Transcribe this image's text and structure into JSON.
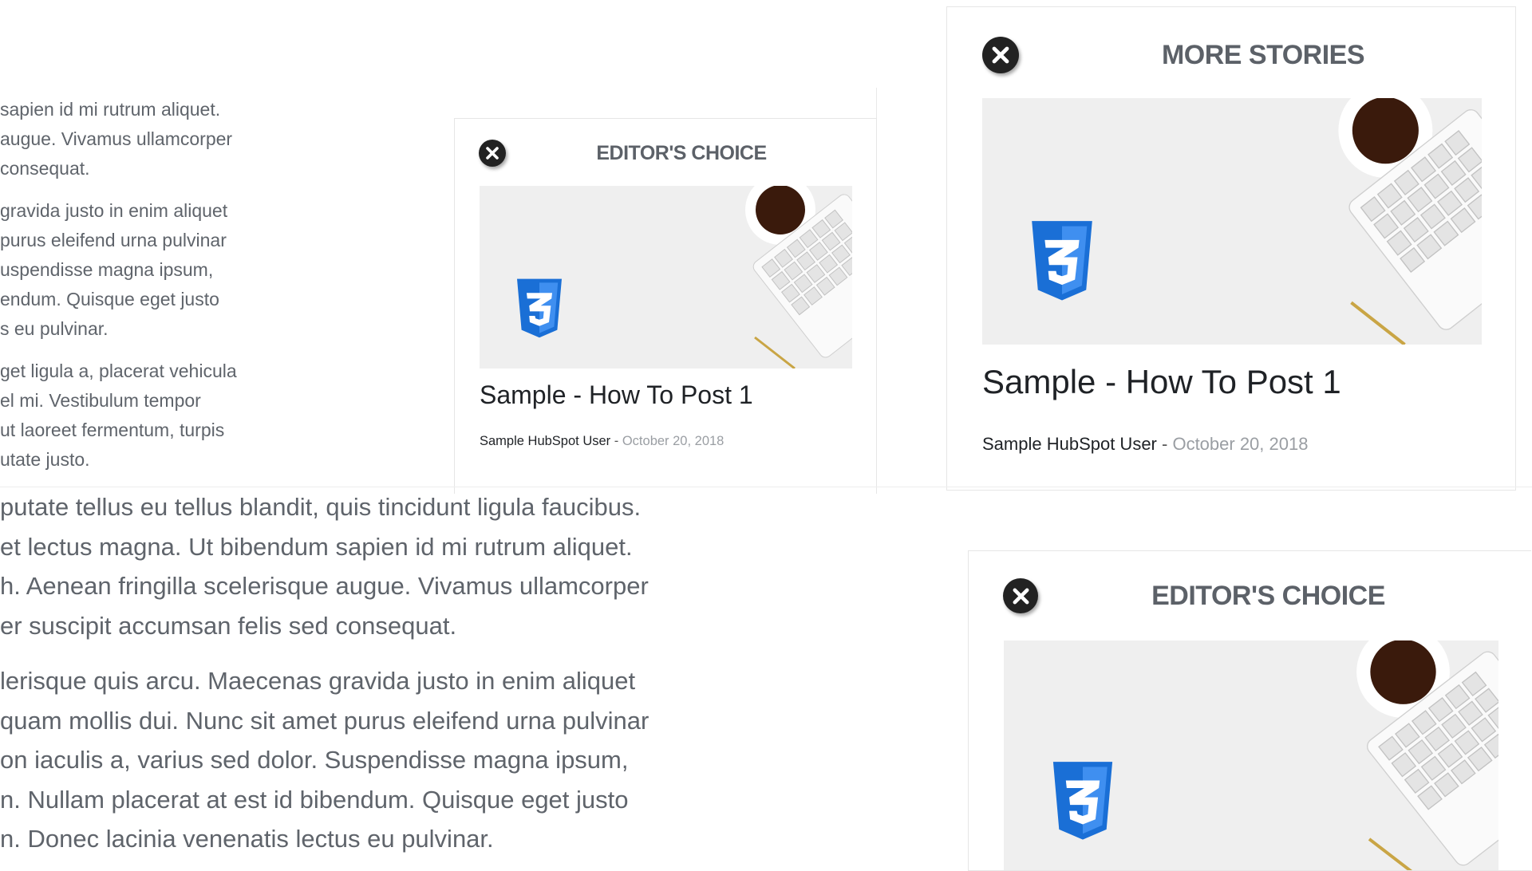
{
  "top_left_paragraphs": [
    [
      "sapien id mi rutrum aliquet.",
      "augue. Vivamus ullamcorper",
      "consequat."
    ],
    [
      "gravida justo in enim aliquet",
      "purus eleifend urna pulvinar",
      "uspendisse magna ipsum,",
      "endum. Quisque eget justo",
      "s eu pulvinar."
    ],
    [
      "get ligula a, placerat vehicula",
      "el mi. Vestibulum tempor",
      "ut laoreet fermentum, turpis",
      "utate justo."
    ]
  ],
  "bottom_left_paragraphs": [
    [
      "putate tellus eu tellus blandit, quis tincidunt ligula faucibus.",
      "et lectus magna. Ut bibendum sapien id mi rutrum aliquet.",
      "h. Aenean fringilla scelerisque augue. Vivamus ullamcorper",
      "er suscipit accumsan felis sed consequat."
    ],
    [
      "lerisque quis arcu. Maecenas gravida justo in enim aliquet",
      "quam mollis dui. Nunc sit amet purus eleifend urna pulvinar",
      "on iaculis a, varius sed dolor. Suspendisse magna ipsum,",
      "n. Nullam placerat at est id bibendum. Quisque eget justo",
      "n. Donec lacinia venenatis lectus eu pulvinar."
    ]
  ],
  "cards": {
    "editors_choice_small": {
      "heading": "EDITOR'S CHOICE",
      "post_title": "Sample - How To Post 1",
      "author": "Sample HubSpot User",
      "separator": " - ",
      "date": "October 20, 2018"
    },
    "more_stories": {
      "heading": "MORE STORIES",
      "post_title": "Sample - How To Post 1",
      "author": "Sample HubSpot User",
      "separator": " - ",
      "date": "October 20, 2018"
    },
    "editors_choice_large": {
      "heading": "EDITOR'S CHOICE"
    }
  },
  "icons": {
    "close": "close-icon",
    "logo": "css3-logo-icon"
  },
  "colors": {
    "css3_blue": "#1a6fd6",
    "close_bg": "#222222",
    "date_gray": "#9a9ea3"
  }
}
